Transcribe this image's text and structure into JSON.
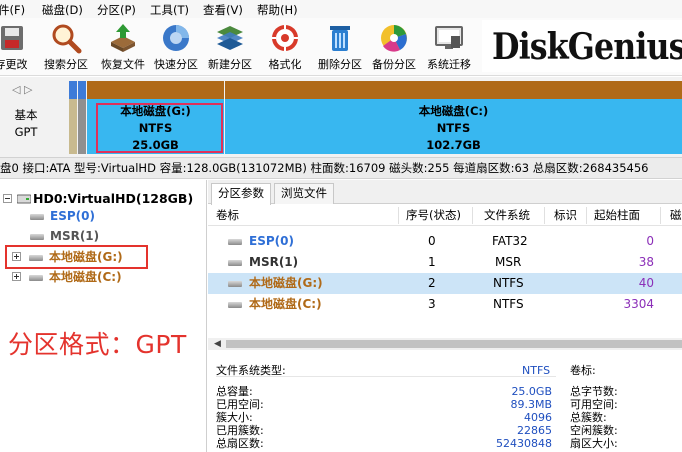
{
  "menu": [
    "件(F)",
    "磁盘(D)",
    "分区(P)",
    "工具(T)",
    "查看(V)",
    "帮助(H)"
  ],
  "toolbar": [
    {
      "label": "存更改",
      "icon": "save-icon"
    },
    {
      "label": "搜索分区",
      "icon": "magnifier-icon"
    },
    {
      "label": "恢复文件",
      "icon": "recover-files-icon"
    },
    {
      "label": "快速分区",
      "icon": "quick-partition-icon"
    },
    {
      "label": "新建分区",
      "icon": "new-partition-icon"
    },
    {
      "label": "格式化",
      "icon": "format-icon"
    },
    {
      "label": "删除分区",
      "icon": "trash-icon"
    },
    {
      "label": "备份分区",
      "icon": "backup-icon"
    },
    {
      "label": "系统迁移",
      "icon": "migrate-icon"
    }
  ],
  "logo_text": "DiskGenius",
  "diskmap": {
    "nav": "◁ ▷",
    "label_line1": "基本",
    "label_line2": "GPT",
    "partitions": [
      {
        "name": "本地磁盘(G:)",
        "fs": "NTFS",
        "size": "25.0GB"
      },
      {
        "name": "本地磁盘(C:)",
        "fs": "NTFS",
        "size": "102.7GB"
      }
    ]
  },
  "infoline": "盘0 接口:ATA  型号:VirtualHD  容量:128.0GB(131072MB)  柱面数:16709  磁头数:255  每道扇区数:63  总扇区数:268435456",
  "tree": {
    "disk": "HD0:VirtualHD(128GB)",
    "items": [
      {
        "label": "ESP(0)"
      },
      {
        "label": "MSR(1)"
      },
      {
        "label": "本地磁盘(G:)"
      },
      {
        "label": "本地磁盘(C:)"
      }
    ]
  },
  "annotation_text": "分区格式：GPT",
  "tabs": [
    "分区参数",
    "浏览文件"
  ],
  "table": {
    "headers": [
      "卷标",
      "序号(状态)",
      "文件系统",
      "标识",
      "起始柱面",
      "磁"
    ],
    "rows": [
      {
        "label": "ESP(0)",
        "index": "0",
        "fs": "FAT32",
        "start": "0"
      },
      {
        "label": "MSR(1)",
        "index": "1",
        "fs": "MSR",
        "start": "38"
      },
      {
        "label": "本地磁盘(G:)",
        "index": "2",
        "fs": "NTFS",
        "start": "40"
      },
      {
        "label": "本地磁盘(C:)",
        "index": "3",
        "fs": "NTFS",
        "start": "3304"
      }
    ]
  },
  "details": {
    "fs_type_label": "文件系统类型:",
    "fs_type_value": "NTFS",
    "volume_label": "卷标:",
    "left": [
      {
        "label": "总容量:",
        "value": "25.0GB"
      },
      {
        "label": "已用空间:",
        "value": "89.3MB"
      },
      {
        "label": "簇大小:",
        "value": "4096"
      },
      {
        "label": "已用簇数:",
        "value": "22865"
      },
      {
        "label": "总扇区数:",
        "value": "52430848"
      }
    ],
    "right": [
      "总字节数:",
      "可用空间:",
      "总簇数:",
      "空闲簇数:",
      "扇区大小:"
    ]
  },
  "colors": {
    "highlight_red": "#e0305a",
    "annotation_red": "#e4332d",
    "ntfs_blue": "#3d8fe8",
    "partition_brown": "#b06a18",
    "number_purple": "#8b2fb8",
    "esp_blue": "#2f6fd6"
  }
}
